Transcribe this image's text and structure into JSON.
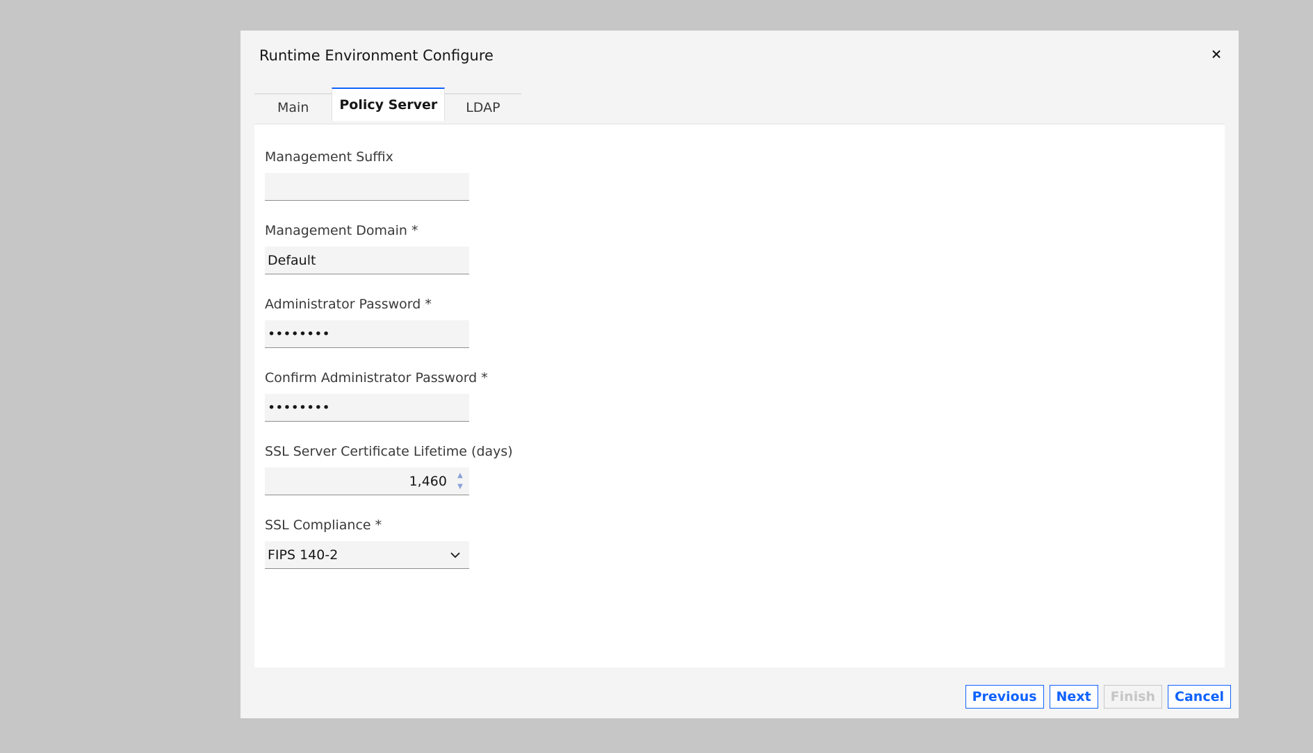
{
  "dialog": {
    "title": "Runtime Environment Configure"
  },
  "tabs": [
    {
      "label": "Main",
      "active": false
    },
    {
      "label": "Policy Server",
      "active": true
    },
    {
      "label": "LDAP",
      "active": false
    }
  ],
  "form": {
    "management_suffix": {
      "label": "Management Suffix",
      "value": ""
    },
    "management_domain": {
      "label": "Management Domain *",
      "value": "Default"
    },
    "admin_password": {
      "label": "Administrator Password *",
      "value": "••••••••"
    },
    "confirm_admin_password": {
      "label": "Confirm Administrator Password *",
      "value": "••••••••"
    },
    "ssl_lifetime": {
      "label": "SSL Server Certificate Lifetime (days)",
      "value": "1,460"
    },
    "ssl_compliance": {
      "label": "SSL Compliance *",
      "value": "FIPS 140-2"
    }
  },
  "footer": {
    "previous": "Previous",
    "next": "Next",
    "finish": "Finish",
    "cancel": "Cancel"
  },
  "colors": {
    "accent": "#0f62fe",
    "backdrop": "#c6c6c6",
    "dialog_bg": "#f4f4f4"
  }
}
